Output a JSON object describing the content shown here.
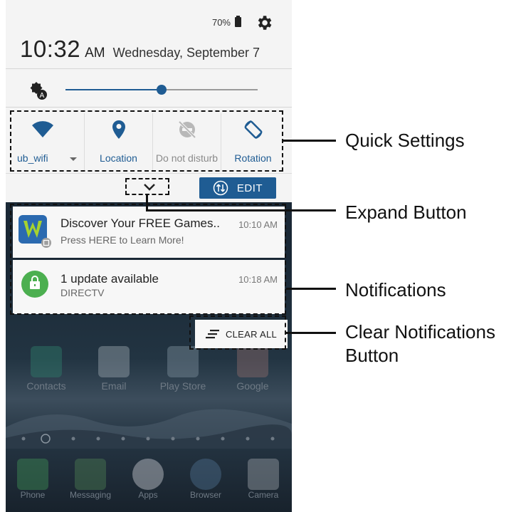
{
  "status_bar": {
    "battery_percent": "70%",
    "settings_icon": "gear-icon"
  },
  "header": {
    "time": "10:32",
    "ampm": "AM",
    "date": "Wednesday, September 7"
  },
  "brightness": {
    "icon": "brightness-auto-icon",
    "level": 0.5
  },
  "quick_settings": [
    {
      "label": "ub_wifi",
      "icon": "wifi-icon",
      "active": true
    },
    {
      "label": "Location",
      "icon": "location-pin-icon",
      "active": true
    },
    {
      "label": "Do not disturb",
      "icon": "do-not-disturb-icon",
      "active": false
    },
    {
      "label": "Rotation",
      "icon": "rotation-icon",
      "active": true
    }
  ],
  "edit_button": {
    "label": "EDIT"
  },
  "notifications": [
    {
      "title": "Discover Your FREE Games..",
      "body": "Press HERE to Learn More!",
      "time": "10:10 AM",
      "icon": "games-app-icon"
    },
    {
      "title": "1 update available",
      "body": "DIRECTV",
      "time": "10:18 AM",
      "icon": "shopping-bag-icon"
    }
  ],
  "clear_all": {
    "label": "CLEAR ALL"
  },
  "home_apps": [
    {
      "label": "Contacts",
      "icon": "contacts-icon"
    },
    {
      "label": "Email",
      "icon": "email-icon"
    },
    {
      "label": "Play Store",
      "icon": "play-store-icon"
    },
    {
      "label": "Google",
      "icon": "google-folder-icon"
    }
  ],
  "dock_apps": [
    {
      "label": "Phone",
      "icon": "phone-icon"
    },
    {
      "label": "Messaging",
      "icon": "messaging-icon"
    },
    {
      "label": "Apps",
      "icon": "apps-grid-icon"
    },
    {
      "label": "Browser",
      "icon": "browser-icon"
    },
    {
      "label": "Camera",
      "icon": "camera-icon"
    }
  ],
  "annotations": {
    "quick_settings": "Quick Settings",
    "expand_button": "Expand Button",
    "notifications": "Notifications",
    "clear_button_line1": "Clear Notifications",
    "clear_button_line2": "Button"
  },
  "colors": {
    "accent": "#1f5c93",
    "shade_bg": "#f4f4f4",
    "directv_green": "#4caf50"
  }
}
